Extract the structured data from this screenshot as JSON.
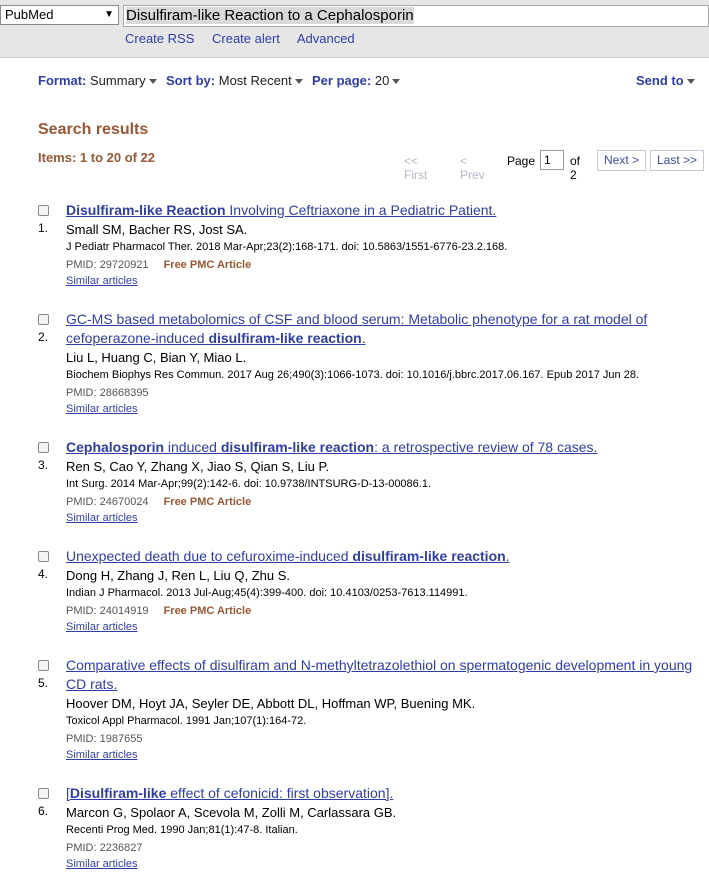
{
  "header": {
    "database": "PubMed",
    "query": "Disulfiram-like Reaction to a Cephalosporin",
    "links": [
      "Create RSS",
      "Create alert",
      "Advanced"
    ]
  },
  "toolbar": {
    "format_label": "Format:",
    "format_value": "Summary",
    "sort_label": "Sort by:",
    "sort_value": "Most Recent",
    "perpage_label": "Per page:",
    "perpage_value": "20",
    "send_to": "Send to"
  },
  "results": {
    "heading": "Search results",
    "items_count": "Items: 1 to 20 of 22",
    "pager": {
      "first": "<< First",
      "prev": "< Prev",
      "page_label": "Page",
      "page_value": "1",
      "of": "of 2",
      "next": "Next >",
      "last": "Last >>"
    },
    "free_pmc": "Free PMC Article",
    "similar": "Similar articles",
    "items": [
      {
        "num": "1.",
        "title_segments": [
          {
            "t": "Disulfiram-like Reaction",
            "b": true
          },
          {
            "t": " Involving Ceftriaxone in a Pediatric Patient.",
            "b": false
          }
        ],
        "authors": "Small SM, Bacher RS, Jost SA.",
        "journal": "J Pediatr Pharmacol Ther. 2018 Mar-Apr;23(2):168-171. doi: 10.5863/1551-6776-23.2.168.",
        "pmid": "PMID: 29720921",
        "pmc": true
      },
      {
        "num": "2.",
        "title_segments": [
          {
            "t": "GC-MS based metabolomics of CSF and blood serum: Metabolic phenotype for a rat model of cefoperazone-induced ",
            "b": false
          },
          {
            "t": "disulfiram-like reaction",
            "b": true
          },
          {
            "t": ".",
            "b": false
          }
        ],
        "authors": "Liu L, Huang C, Bian Y, Miao L.",
        "journal": "Biochem Biophys Res Commun. 2017 Aug 26;490(3):1066-1073. doi: 10.1016/j.bbrc.2017.06.167. Epub 2017 Jun 28.",
        "pmid": "PMID: 28668395",
        "pmc": false
      },
      {
        "num": "3.",
        "title_segments": [
          {
            "t": "Cephalosporin",
            "b": true
          },
          {
            "t": " induced ",
            "b": false
          },
          {
            "t": "disulfiram-like reaction",
            "b": true
          },
          {
            "t": ": a retrospective review of 78 cases.",
            "b": false
          }
        ],
        "authors": "Ren S, Cao Y, Zhang X, Jiao S, Qian S, Liu P.",
        "journal": "Int Surg. 2014 Mar-Apr;99(2):142-6. doi: 10.9738/INTSURG-D-13-00086.1.",
        "pmid": "PMID: 24670024",
        "pmc": true
      },
      {
        "num": "4.",
        "title_segments": [
          {
            "t": "Unexpected death due to cefuroxime-induced ",
            "b": false
          },
          {
            "t": "disulfiram-like reaction",
            "b": true
          },
          {
            "t": ".",
            "b": false
          }
        ],
        "authors": "Dong H, Zhang J, Ren L, Liu Q, Zhu S.",
        "journal": "Indian J Pharmacol. 2013 Jul-Aug;45(4):399-400. doi: 10.4103/0253-7613.114991.",
        "pmid": "PMID: 24014919",
        "pmc": true
      },
      {
        "num": "5.",
        "title_segments": [
          {
            "t": "Comparative effects of disulfiram and N-methyltetrazolethiol on spermatogenic development in young CD rats.",
            "b": false
          }
        ],
        "authors": "Hoover DM, Hoyt JA, Seyler DE, Abbott DL, Hoffman WP, Buening MK.",
        "journal": "Toxicol Appl Pharmacol. 1991 Jan;107(1):164-72.",
        "pmid": "PMID: 1987655",
        "pmc": false
      },
      {
        "num": "6.",
        "title_segments": [
          {
            "t": "[",
            "b": false
          },
          {
            "t": "Disulfiram-like",
            "b": true
          },
          {
            "t": " effect of cefonicid: first observation].",
            "b": false
          }
        ],
        "authors": "Marcon G, Spolaor A, Scevola M, Zolli M, Carlassara GB.",
        "journal": "Recenti Prog Med. 1990 Jan;81(1):47-8. Italian.",
        "pmid": "PMID: 2236827",
        "pmc": false
      }
    ]
  }
}
